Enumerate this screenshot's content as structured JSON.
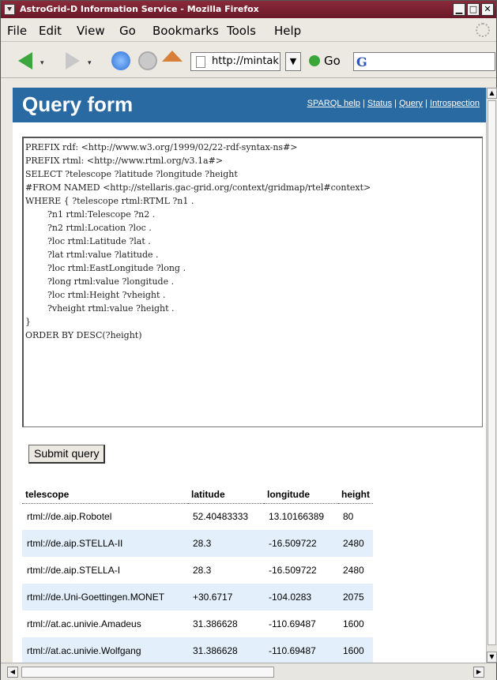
{
  "window": {
    "title": "AstroGrid-D Information Service - Mozilla Firefox",
    "minimize": "▁",
    "maximize": "□",
    "close": "✕"
  },
  "menu": [
    "File",
    "Edit",
    "View",
    "Go",
    "Bookmarks",
    "Tools",
    "Help"
  ],
  "toolbar": {
    "url": "http://mintak",
    "go_label": "Go",
    "search_engine_glyph": "G"
  },
  "page": {
    "title": "Query form",
    "nav_links": [
      "SPARQL help",
      "Status",
      "Query",
      "Introspection"
    ],
    "query_text": "PREFIX rdf: <http://www.w3.org/1999/02/22-rdf-syntax-ns#>\nPREFIX rtml: <http://www.rtml.org/v3.1a#>\nSELECT ?telescope ?latitude ?longitude ?height\n#FROM NAMED <http://stellaris.gac-grid.org/context/gridmap/rtel#context>\nWHERE { ?telescope rtml:RTML ?n1 .\n        ?n1 rtml:Telescope ?n2 .\n        ?n2 rtml:Location ?loc .\n        ?loc rtml:Latitude ?lat .\n        ?lat rtml:value ?latitude .\n        ?loc rtml:EastLongitude ?long .\n        ?long rtml:value ?longitude .\n        ?loc rtml:Height ?vheight .\n        ?vheight rtml:value ?height .\n}\nORDER BY DESC(?height)",
    "submit_label": "Submit query",
    "results": {
      "columns": [
        "telescope",
        "latitude",
        "longitude",
        "height"
      ],
      "rows": [
        [
          "rtml://de.aip.Robotel",
          "52.40483333",
          "13.10166389",
          "80"
        ],
        [
          "rtml://de.aip.STELLA-II",
          "28.3",
          "-16.509722",
          "2480"
        ],
        [
          "rtml://de.aip.STELLA-I",
          "28.3",
          "-16.509722",
          "2480"
        ],
        [
          "rtml://de.Uni-Goettingen.MONET",
          "+30.6717",
          "-104.0283",
          "2075"
        ],
        [
          "rtml://at.ac.univie.Amadeus",
          "31.386628",
          "-110.69487",
          "1600"
        ],
        [
          "rtml://at.ac.univie.Wolfgang",
          "31.386628",
          "-110.69487",
          "1600"
        ]
      ]
    }
  },
  "colors": {
    "header_band": "#2a6aa3",
    "row_alt": "#e3effa",
    "titlebar": "#7a2030"
  }
}
